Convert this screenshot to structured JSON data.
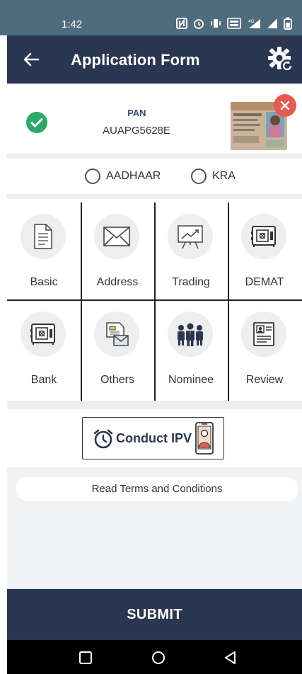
{
  "status_bar": {
    "time": "1:42"
  },
  "header": {
    "title": "Application Form"
  },
  "pan": {
    "label": "PAN",
    "number": "AUAPG5628E"
  },
  "radio_options": [
    {
      "label": "AADHAAR",
      "selected": false
    },
    {
      "label": "KRA",
      "selected": false
    }
  ],
  "tiles": [
    {
      "label": "Basic",
      "icon": "document-icon"
    },
    {
      "label": "Address",
      "icon": "envelope-icon"
    },
    {
      "label": "Trading",
      "icon": "chart-board-icon"
    },
    {
      "label": "DEMAT",
      "icon": "safe-icon"
    },
    {
      "label": "Bank",
      "icon": "safe-icon"
    },
    {
      "label": "Others",
      "icon": "form-envelope-icon"
    },
    {
      "label": "Nominee",
      "icon": "people-icon"
    },
    {
      "label": "Review",
      "icon": "id-form-icon"
    }
  ],
  "ipv": {
    "label": "Conduct IPV"
  },
  "terms": {
    "label": "Read Terms and Conditions"
  },
  "submit": {
    "label": "SUBMIT"
  },
  "colors": {
    "header": "#2b3650",
    "status_bar": "#4f6c7e",
    "success": "#2fa76b",
    "remove": "#e65a52",
    "panel": "#eceeef"
  }
}
